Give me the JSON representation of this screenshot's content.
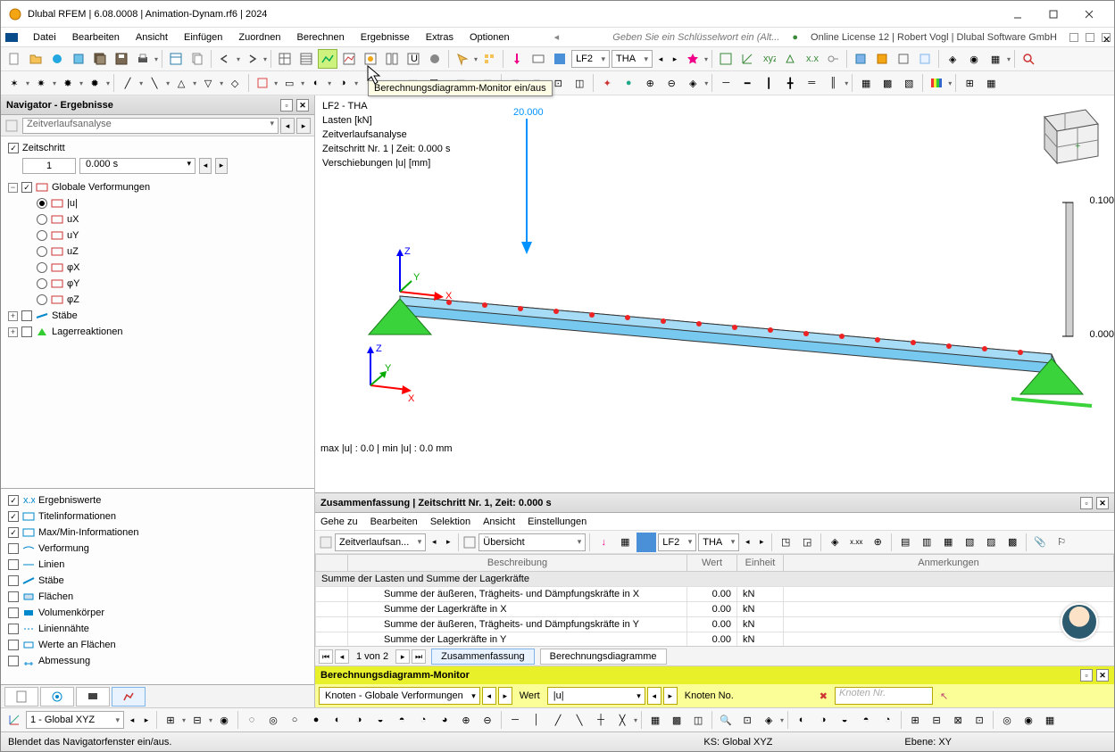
{
  "window": {
    "title": "Dlubal RFEM | 6.08.0008 | Animation-Dynam.rf6 | 2024"
  },
  "menu": {
    "items": [
      "Datei",
      "Bearbeiten",
      "Ansicht",
      "Einfügen",
      "Zuordnen",
      "Berechnen",
      "Ergebnisse",
      "Extras",
      "Optionen"
    ],
    "search_placeholder": "Geben Sie ein Schlüsselwort ein (Alt...",
    "license": "Online License 12 | Robert Vogl | Dlubal Software GmbH"
  },
  "tooltip": "Berechnungsdiagramm-Monitor ein/aus",
  "toolbar_dd": {
    "lf": "LF2",
    "type": "THA"
  },
  "nav": {
    "title": "Navigator - Ergebnisse",
    "analysis": "Zeitverlaufsanalyse",
    "timestep": {
      "label": "Zeitschritt",
      "num": "1",
      "value": "0.000 s"
    },
    "globdef": "Globale Verformungen",
    "comps": [
      "|u|",
      "uX",
      "uY",
      "uZ",
      "φX",
      "φY",
      "φZ"
    ],
    "staebe": "Stäbe",
    "lager": "Lagerreaktionen",
    "opts": [
      "Ergebniswerte",
      "Titelinformationen",
      "Max/Min-Informationen",
      "Verformung",
      "Linien",
      "Stäbe",
      "Flächen",
      "Volumenkörper",
      "Liniennähte",
      "Werte an Flächen",
      "Abmessung"
    ]
  },
  "view": {
    "lines": [
      "LF2 - THA",
      "Lasten [kN]",
      "Zeitverlaufsanalyse",
      "Zeitschritt Nr. 1 | Zeit: 0.000 s",
      "Verschiebungen |u| [mm]"
    ],
    "load_value": "20.000",
    "maxmin": "max |u| : 0.0 | min |u| : 0.0 mm",
    "scale_top": "0.100",
    "scale_bot": "0.000"
  },
  "summary": {
    "title": "Zusammenfassung | Zeitschritt Nr. 1, Zeit: 0.000 s",
    "menu": [
      "Gehe zu",
      "Bearbeiten",
      "Selektion",
      "Ansicht",
      "Einstellungen"
    ],
    "tb": {
      "dd1": "Zeitverlaufsan...",
      "overview": "Übersicht",
      "lf": "LF2",
      "type": "THA"
    },
    "cols": [
      "Beschreibung",
      "Wert",
      "Einheit",
      "Anmerkungen"
    ],
    "group": "Summe der Lasten und Summe der Lagerkräfte",
    "rows": [
      {
        "d": "Summe der äußeren, Trägheits- und Dämpfungskräfte in X",
        "w": "0.00",
        "e": "kN"
      },
      {
        "d": "Summe der Lagerkräfte in X",
        "w": "0.00",
        "e": "kN"
      },
      {
        "d": "Summe der äußeren, Trägheits- und Dämpfungskräfte in Y",
        "w": "0.00",
        "e": "kN"
      },
      {
        "d": "Summe der Lagerkräfte in Y",
        "w": "0.00",
        "e": "kN"
      }
    ],
    "page": "1 von 2",
    "tabs": [
      "Zusammenfassung",
      "Berechnungsdiagramme"
    ]
  },
  "monitor": {
    "title": "Berechnungsdiagramm-Monitor",
    "dd1": "Knoten - Globale Verformungen",
    "wert": "Wert",
    "wertval": "|u|",
    "knotenno": "Knoten No.",
    "knotennr": "Knoten Nr."
  },
  "bottom": {
    "ks": "1 - Global XYZ"
  },
  "status": {
    "hint": "Blendet das Navigatorfenster ein/aus.",
    "ks": "KS: Global XYZ",
    "ebene": "Ebene: XY"
  }
}
